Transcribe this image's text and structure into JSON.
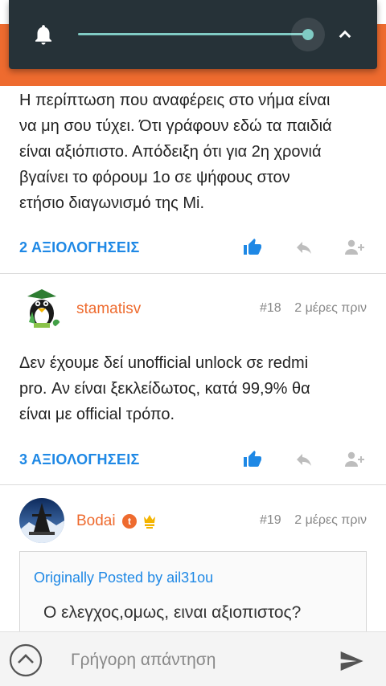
{
  "volume": {
    "level": 1.0,
    "accent_color": "#80cbc4",
    "icons": {
      "bell": "bell-icon",
      "collapse": "chevron-up-icon"
    }
  },
  "posts": [
    {
      "text_lines": [
        "Η περίπτωση που αναφέρεις στο νήμα είναι",
        "να μη σου τύχει. Ότι γράφουν εδώ τα παιδιά",
        "είναι αξιόπιστο. Απόδειξη ότι για 2η χρονιά",
        "βγαίνει το φόρουμ 1ο σε ψήφους στον",
        "ετήσιο διαγωνισμό της Mi."
      ],
      "ratings_label": "2 ΑΞΙΟΛΟΓΗΣΕΙΣ"
    },
    {
      "username": "stamatisv",
      "number": "#18",
      "time": "2 μέρες πριν",
      "text_lines": [
        "Δεν έχουμε δεί unofficial unlock σε redmi",
        "pro. Αν είναι ξεκλείδωτος, κατά 99,9% θα",
        "είναι με official τρόπο."
      ],
      "ratings_label": "3 ΑΞΙΟΛΟΓΗΣΕΙΣ"
    },
    {
      "username": "Bodai",
      "badge_letter": "t",
      "number": "#19",
      "time": "2 μέρες πριν",
      "quote": {
        "header": "Originally Posted by ail31ou",
        "text": "Ο ελεγχος,ομως, ειναι αξιοπιστος?"
      }
    }
  ],
  "reply_bar": {
    "placeholder": "Γρήγορη απάντηση"
  },
  "colors": {
    "brand_orange": "#ee6b2f",
    "link_blue": "#1e88e5",
    "icon_grey": "#bdbdbd"
  }
}
